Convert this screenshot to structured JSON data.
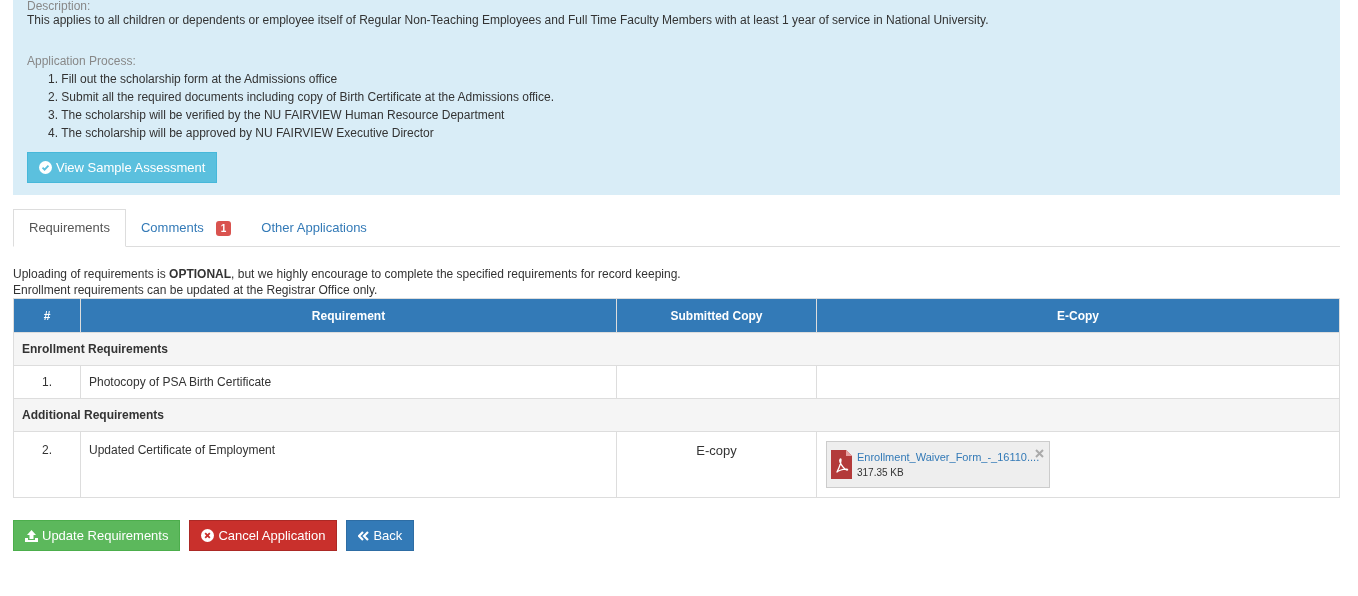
{
  "info_panel": {
    "description_label": "Description:",
    "description": "This applies to all children or dependents or employee itself of Regular Non-Teaching Employees and Full Time Faculty Members with at least 1 year of service in National University.",
    "process_label": "Application Process:",
    "steps": [
      {
        "number": "1.",
        "text": "Fill out the scholarship form at the Admissions office"
      },
      {
        "number": "2.",
        "text": "Submit all the required documents including copy of Birth Certificate at the Admissions office."
      },
      {
        "number": "3.",
        "text": "The scholarship will be verified by the NU FAIRVIEW Human Resource Department"
      },
      {
        "number": "4.",
        "text": "The scholarship will be approved by NU FAIRVIEW Executive Director"
      }
    ],
    "button": "View Sample Assessment"
  },
  "tabs": [
    {
      "label": "Requirements",
      "selected": true
    },
    {
      "label": "Comments",
      "selected": false,
      "badge": "1"
    },
    {
      "label": "Other Applications",
      "selected": false
    }
  ],
  "notes": [
    "Uploading of requirements is **OPTIONAL**, but we highly encourage to complete the specified requirements for record keeping.",
    "Enrollment requirements can be updated at the Registrar Office only."
  ],
  "table": {
    "columns": [
      "#",
      "Requirement",
      "Submitted Copy",
      "E-Copy"
    ],
    "rows": [
      {
        "kind": "group",
        "label": "Enrollment Requirements"
      },
      {
        "kind": "item",
        "number": "1.",
        "requirement": "Photocopy of PSA Birth Certificate"
      },
      {
        "kind": "group",
        "label": "Additional Requirements"
      },
      {
        "kind": "item",
        "number": "2.",
        "requirement": "Updated Certificate of Employment",
        "submitted": "E-copy",
        "file": {
          "name": "Enrollment_Waiver_Form_-_16110....",
          "size": "317.35 KB"
        }
      }
    ]
  },
  "buttons": [
    {
      "kind": "update",
      "label": "Update Requirements"
    },
    {
      "kind": "cancel",
      "label": "Cancel Application"
    },
    {
      "kind": "back",
      "label": "Back"
    }
  ]
}
